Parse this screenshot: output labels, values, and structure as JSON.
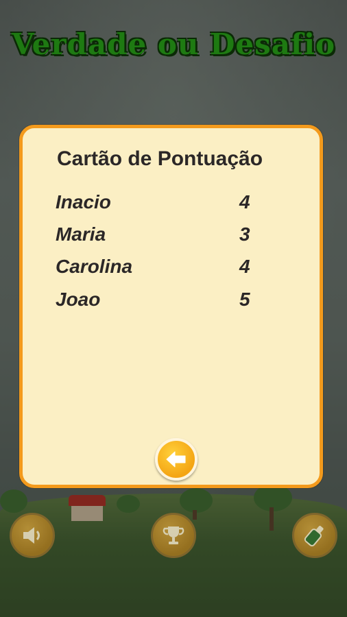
{
  "app": {
    "title": "Verdade ou Desafio"
  },
  "scorecard": {
    "title": "Cartão de Pontuação",
    "players": [
      {
        "name": "Inacio",
        "score": "4"
      },
      {
        "name": "Maria",
        "score": "3"
      },
      {
        "name": "Carolina",
        "score": "4"
      },
      {
        "name": "Joao",
        "score": "5"
      }
    ],
    "back_icon": "arrow-left-icon"
  },
  "bottom_bar": {
    "buttons": [
      "speaker-icon",
      "trophy-icon",
      "bottle-icon"
    ]
  },
  "colors": {
    "title_green": "#1e7a12",
    "card_bg": "#fbefc4",
    "card_border": "#f39a1c",
    "button_orange": "#f4a514"
  }
}
